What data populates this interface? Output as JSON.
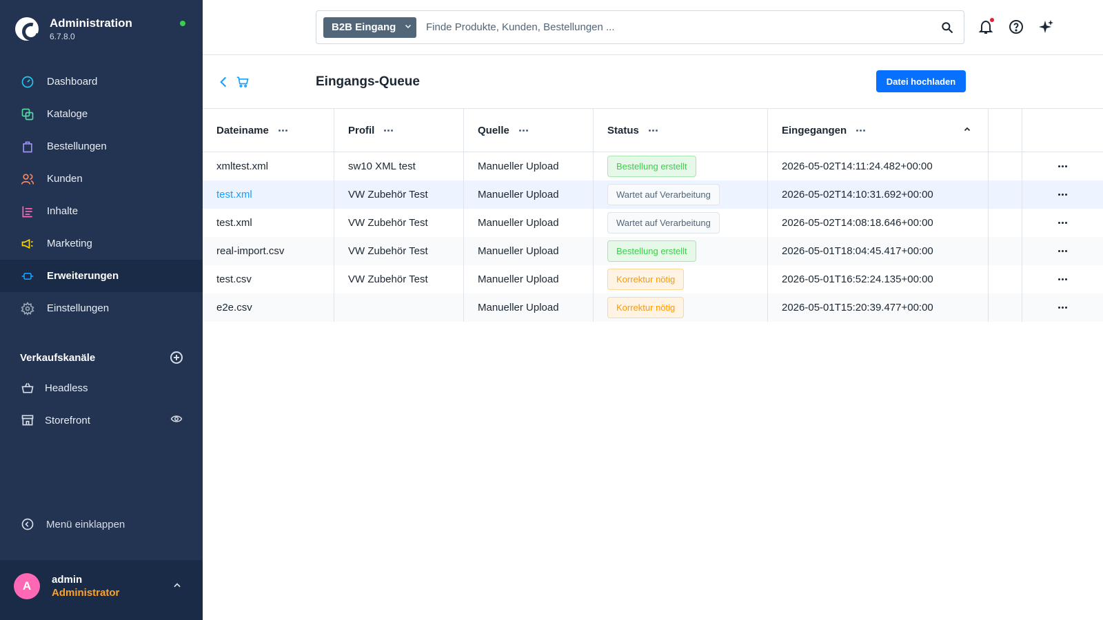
{
  "app": {
    "title": "Administration",
    "version": "6.7.8.0"
  },
  "nav": {
    "items": [
      {
        "label": "Dashboard",
        "icon": "dashboard-icon",
        "color": "#29c6f0"
      },
      {
        "label": "Kataloge",
        "icon": "catalog-icon",
        "color": "#57d9a3"
      },
      {
        "label": "Bestellungen",
        "icon": "orders-icon",
        "color": "#a092f0"
      },
      {
        "label": "Kunden",
        "icon": "customers-icon",
        "color": "#f88962"
      },
      {
        "label": "Inhalte",
        "icon": "content-icon",
        "color": "#ff68b4"
      },
      {
        "label": "Marketing",
        "icon": "marketing-icon",
        "color": "#ffd700"
      },
      {
        "label": "Erweiterungen",
        "icon": "extensions-icon",
        "color": "#189eff",
        "active": true
      },
      {
        "label": "Einstellungen",
        "icon": "settings-icon",
        "color": "#9aa8b5"
      }
    ],
    "sales_channels_title": "Verkaufskanäle",
    "channels": [
      {
        "label": "Headless",
        "icon": "basket-icon"
      },
      {
        "label": "Storefront",
        "icon": "storefront-icon"
      }
    ],
    "collapse_label": "Menü einklappen"
  },
  "user": {
    "initial": "A",
    "name": "admin",
    "role": "Administrator"
  },
  "search": {
    "type_label": "B2B Eingang",
    "placeholder": "Finde Produkte, Kunden, Bestellungen ..."
  },
  "page": {
    "title": "Eingangs-Queue",
    "upload_button": "Datei hochladen"
  },
  "table": {
    "columns": [
      "Dateiname",
      "Profil",
      "Quelle",
      "Status",
      "Eingegangen"
    ],
    "rows": [
      {
        "file": "xmltest.xml",
        "profile": "sw10 XML test",
        "source": "Manueller Upload",
        "status": "Bestellung erstellt",
        "status_type": "success",
        "received": "2026-05-02T14:11:24.482+00:00"
      },
      {
        "file": "test.xml",
        "profile": "VW Zubehör Test",
        "source": "Manueller Upload",
        "status": "Wartet auf Verarbeitung",
        "status_type": "neutral",
        "received": "2026-05-02T14:10:31.692+00:00"
      },
      {
        "file": "test.xml",
        "profile": "VW Zubehör Test",
        "source": "Manueller Upload",
        "status": "Wartet auf Verarbeitung",
        "status_type": "neutral",
        "received": "2026-05-02T14:08:18.646+00:00"
      },
      {
        "file": "real-import.csv",
        "profile": "VW Zubehör Test",
        "source": "Manueller Upload",
        "status": "Bestellung erstellt",
        "status_type": "success",
        "received": "2026-05-01T18:04:45.417+00:00"
      },
      {
        "file": "test.csv",
        "profile": "VW Zubehör Test",
        "source": "Manueller Upload",
        "status": "Korrektur nötig",
        "status_type": "warning",
        "received": "2026-05-01T16:52:24.135+00:00"
      },
      {
        "file": "e2e.csv",
        "profile": "",
        "source": "Manueller Upload",
        "status": "Korrektur nötig",
        "status_type": "warning",
        "received": "2026-05-01T15:20:39.477+00:00"
      }
    ]
  }
}
